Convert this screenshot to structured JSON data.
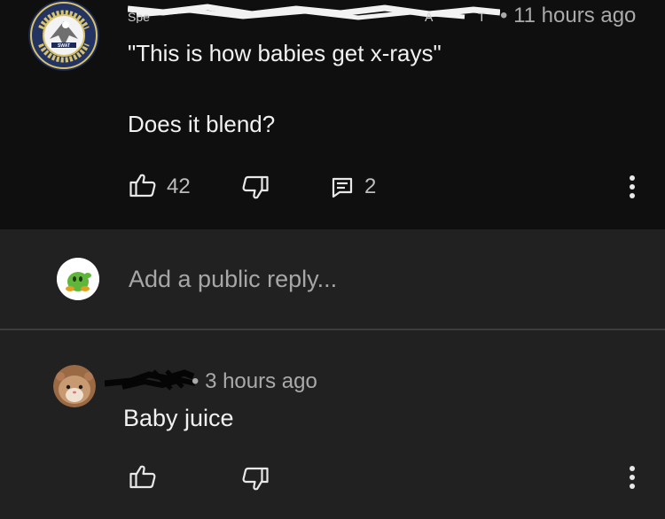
{
  "comment": {
    "time_label": "• 11 hours ago",
    "line1": "\"This is how babies get x-rays\"",
    "line2": "Does it blend?",
    "likes": "42",
    "replies": "2"
  },
  "reply_box": {
    "placeholder": "Add a public reply..."
  },
  "reply_comment": {
    "time_label": "• 3 hours ago",
    "text": "Baby juice"
  },
  "icons": {
    "like": "thumbs-up-icon",
    "dislike": "thumbs-down-icon",
    "reply": "comment-reply-icon",
    "more": "more-vertical-icon"
  }
}
